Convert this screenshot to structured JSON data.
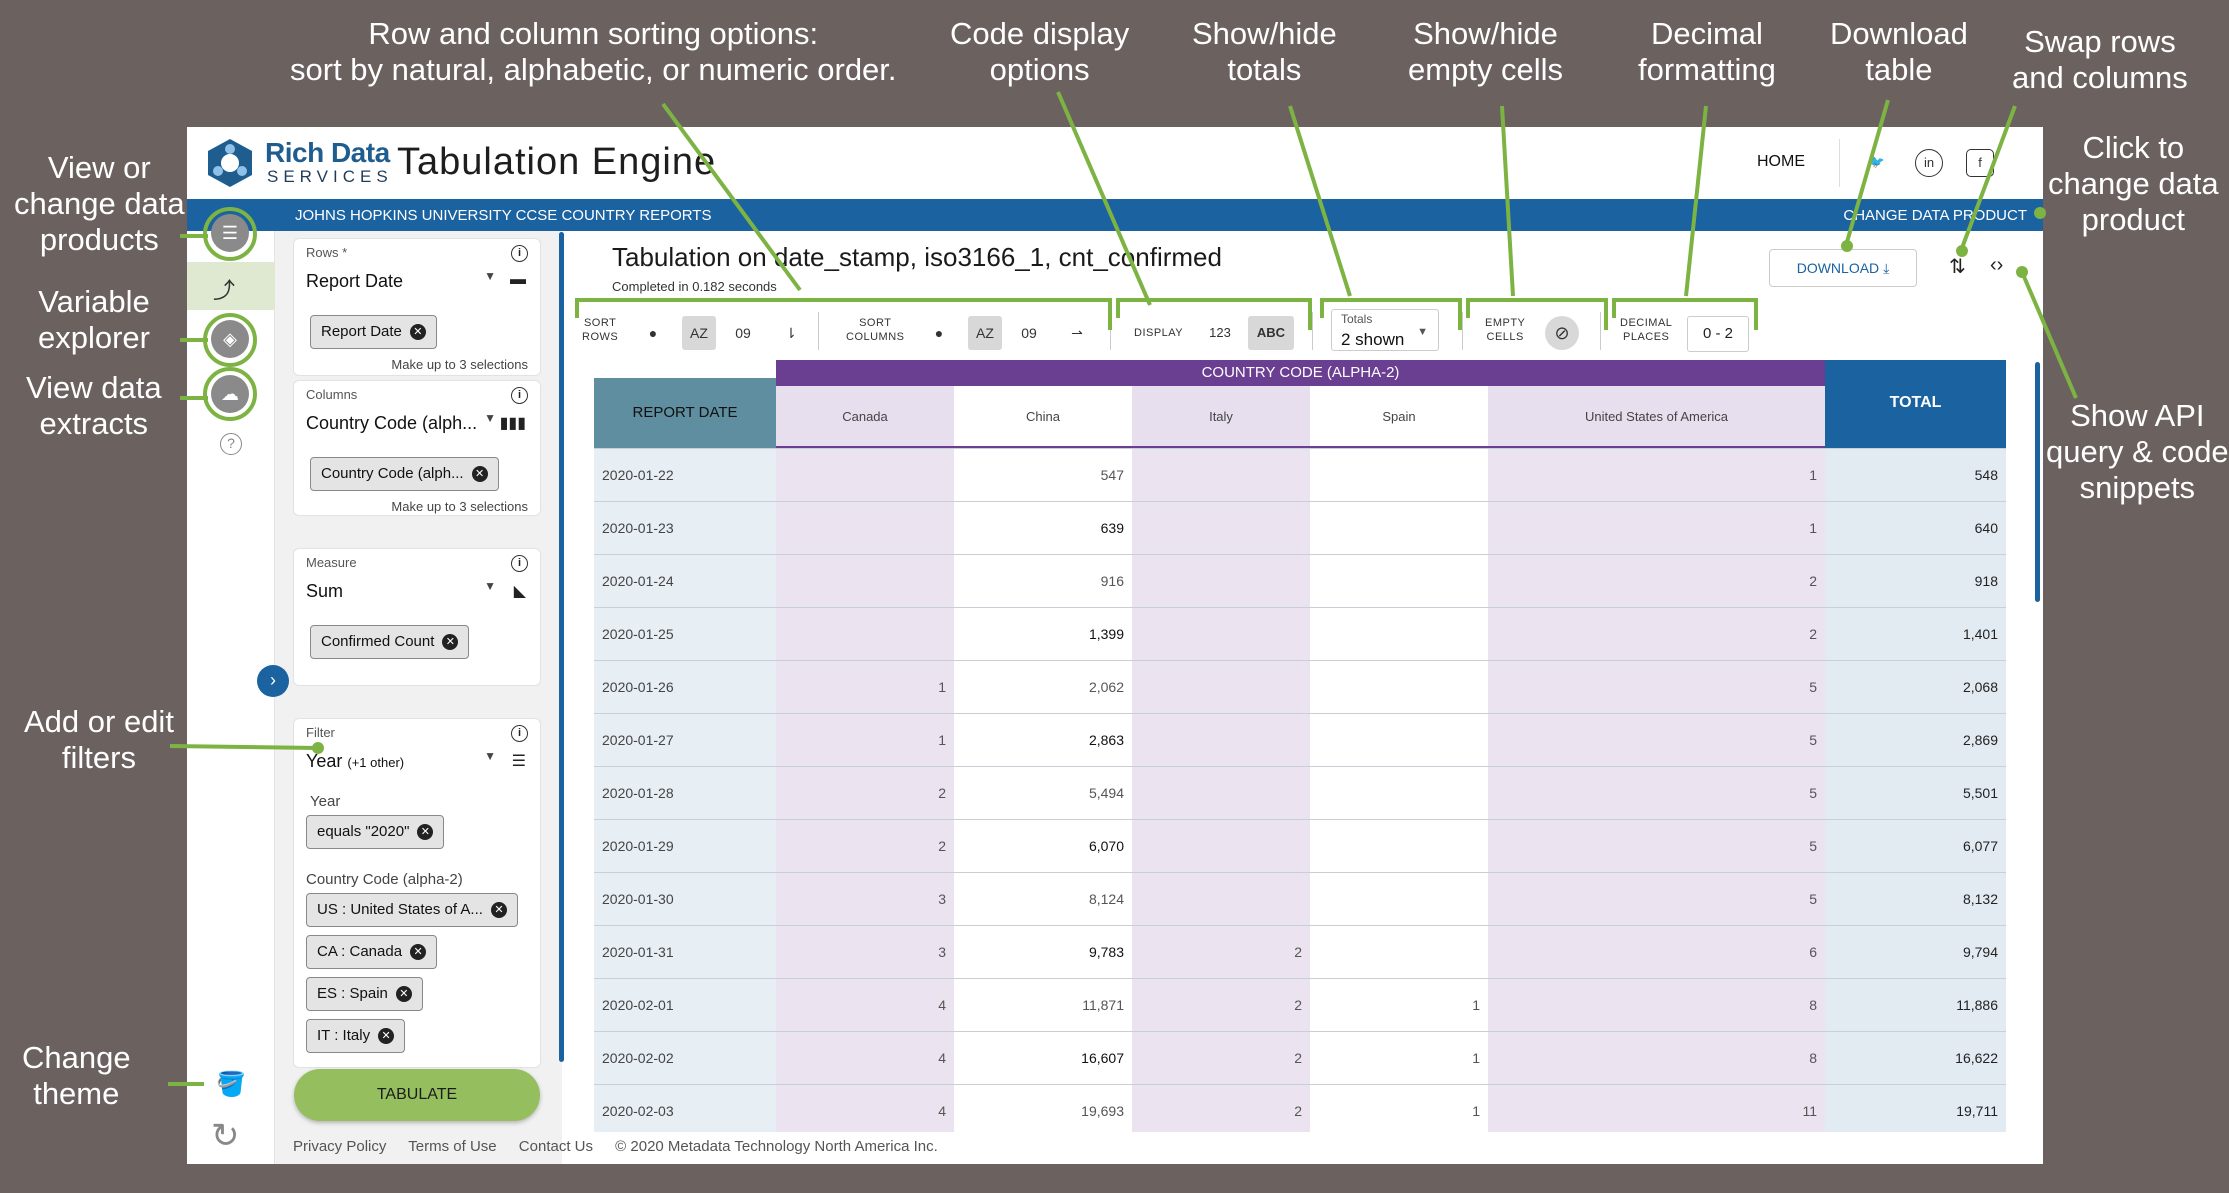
{
  "app": {
    "logo_line1": "Rich Data",
    "logo_line2": "SERVICES",
    "title": "Tabulation Engine",
    "home": "HOME",
    "banner_left": "JOHNS HOPKINS UNIVERSITY CCSE COUNTRY REPORTS",
    "banner_right": "CHANGE DATA PRODUCT",
    "social": [
      "twitter-icon",
      "linkedin-icon",
      "facebook-icon"
    ]
  },
  "annotations": {
    "sorting": [
      "Row and column sorting options:",
      "sort by natural, alphabetic, or numeric order."
    ],
    "code_display": [
      "Code display",
      "options"
    ],
    "totals": [
      "Show/hide",
      "totals"
    ],
    "empty": [
      "Show/hide",
      "empty cells"
    ],
    "decimal": [
      "Decimal",
      "formatting"
    ],
    "download": [
      "Download",
      "table"
    ],
    "swap": [
      "Swap rows",
      "and columns"
    ],
    "change_product": [
      "Click to",
      "change data",
      "product"
    ],
    "view_products": [
      "View or",
      "change data",
      "products"
    ],
    "variable": [
      "Variable",
      "explorer"
    ],
    "extracts": [
      "View data",
      "extracts"
    ],
    "filters": [
      "Add or edit",
      "filters"
    ],
    "theme": [
      "Change",
      "theme"
    ],
    "api": [
      "Show API",
      "query & code",
      "snippets"
    ]
  },
  "sidebar": {
    "rows": {
      "label": "Rows *",
      "value": "Report Date",
      "chip": "Report Date",
      "hint": "Make up to 3 selections"
    },
    "columns": {
      "label": "Columns",
      "value": "Country Code (alph...",
      "chip": "Country Code (alph...",
      "hint": "Make up to 3 selections"
    },
    "measure": {
      "label": "Measure",
      "value": "Sum",
      "chip": "Confirmed Count"
    },
    "filter": {
      "label": "Filter",
      "value": "Year",
      "value_extra": "(+1 other)",
      "year_label": "Year",
      "year_chip": "equals \"2020\"",
      "country_label": "Country Code (alpha-2)",
      "country_chips": [
        "US : United States of A...",
        "CA : Canada",
        "ES : Spain",
        "IT : Italy"
      ]
    },
    "tabulate": "TABULATE"
  },
  "main": {
    "title": "Tabulation on date_stamp, iso3166_1, cnt_confirmed",
    "subtitle": "Completed in 0.182 seconds",
    "download": "DOWNLOAD",
    "toolbar": {
      "sort_rows": [
        "SORT",
        "ROWS"
      ],
      "sort_columns": [
        "SORT",
        "COLUMNS"
      ],
      "display": "DISPLAY",
      "display_codes": "123",
      "display_labels": "ABC",
      "totals_label": "Totals",
      "totals_value": "2 shown",
      "empty": [
        "EMPTY",
        "CELLS"
      ],
      "decimal": [
        "DECIMAL",
        "PLACES"
      ],
      "decimal_value": "0 - 2",
      "az": "AZ",
      "num": "09"
    }
  },
  "table": {
    "group_header": "COUNTRY CODE (ALPHA-2)",
    "row_header": "REPORT DATE",
    "total_header": "TOTAL",
    "columns": [
      "Canada",
      "China",
      "Italy",
      "Spain",
      "United States of America"
    ],
    "rows": [
      {
        "date": "2020-01-22",
        "vals": [
          "",
          "547",
          "",
          "",
          "1"
        ],
        "total": "548"
      },
      {
        "date": "2020-01-23",
        "vals": [
          "",
          "639",
          "",
          "",
          "1"
        ],
        "total": "640"
      },
      {
        "date": "2020-01-24",
        "vals": [
          "",
          "916",
          "",
          "",
          "2"
        ],
        "total": "918"
      },
      {
        "date": "2020-01-25",
        "vals": [
          "",
          "1,399",
          "",
          "",
          "2"
        ],
        "total": "1,401"
      },
      {
        "date": "2020-01-26",
        "vals": [
          "1",
          "2,062",
          "",
          "",
          "5"
        ],
        "total": "2,068"
      },
      {
        "date": "2020-01-27",
        "vals": [
          "1",
          "2,863",
          "",
          "",
          "5"
        ],
        "total": "2,869"
      },
      {
        "date": "2020-01-28",
        "vals": [
          "2",
          "5,494",
          "",
          "",
          "5"
        ],
        "total": "5,501"
      },
      {
        "date": "2020-01-29",
        "vals": [
          "2",
          "6,070",
          "",
          "",
          "5"
        ],
        "total": "6,077"
      },
      {
        "date": "2020-01-30",
        "vals": [
          "3",
          "8,124",
          "",
          "",
          "5"
        ],
        "total": "8,132"
      },
      {
        "date": "2020-01-31",
        "vals": [
          "3",
          "9,783",
          "2",
          "",
          "6"
        ],
        "total": "9,794"
      },
      {
        "date": "2020-02-01",
        "vals": [
          "4",
          "11,871",
          "2",
          "1",
          "8"
        ],
        "total": "11,886"
      },
      {
        "date": "2020-02-02",
        "vals": [
          "4",
          "16,607",
          "2",
          "1",
          "8"
        ],
        "total": "16,622"
      },
      {
        "date": "2020-02-03",
        "vals": [
          "4",
          "19,693",
          "2",
          "1",
          "11"
        ],
        "total": "19,711"
      }
    ]
  },
  "footer": {
    "privacy": "Privacy Policy",
    "terms": "Terms of Use",
    "contact": "Contact Us",
    "copyright": "© 2020 Metadata Technology North America Inc."
  },
  "colors": {
    "accent_green": "#7db343",
    "brand_blue": "#1a62a0",
    "purple": "#6a3e91"
  }
}
